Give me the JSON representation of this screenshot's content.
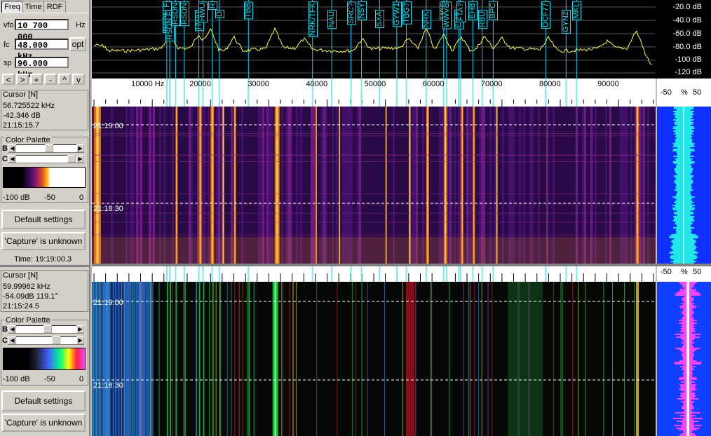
{
  "tabs": [
    "Freq",
    "Time",
    "RDF"
  ],
  "params": {
    "vfo_label": "vfo",
    "vfo_value": "10 700 000",
    "vfo_unit": "Hz",
    "fc_label": "fc",
    "fc_value": "48.000 kHz",
    "sp_label": "sp",
    "sp_value": "96.000 kHz",
    "opt_label": "opt"
  },
  "nav_buttons": [
    "<",
    ">",
    "+",
    "-",
    "^",
    "v"
  ],
  "panel1": {
    "cursor_title": "Cursor [N]",
    "cursor_freq": "56.725522 kHz",
    "cursor_level": "-42.346 dB",
    "cursor_time": "21:15:15.7",
    "palette_title": "Color Palette",
    "b_label": "B",
    "c_label": "C",
    "palette_min": "-100 dB",
    "palette_mid": "-50",
    "palette_max": "0",
    "default_btn": "Default settings",
    "capture_btn": "'Capture' is unknown",
    "time_status": "Time:  19:19:00.3"
  },
  "panel2": {
    "cursor_title": "Cursor [N]",
    "cursor_freq": "59.99962 kHz",
    "cursor_level": "-54.09dB 119.1°",
    "cursor_time": "21:15:24.5",
    "palette_title": "Color Palette",
    "b_label": "B",
    "c_label": "C",
    "palette_min": "-100 dB",
    "palette_mid": "-50",
    "palette_max": "0",
    "default_btn": "Default settings",
    "capture_btn": "'Capture' is unknown"
  },
  "db_scale": [
    "-20.0 dB",
    "-40.0 dB",
    "-60.0 dB",
    "-80.0 dB",
    "-100 dB",
    "-120 dB"
  ],
  "freq_axis": [
    "10000 Hz",
    "20000",
    "30000",
    "40000",
    "50000",
    "60000",
    "70000",
    "80000",
    "90000"
  ],
  "pct_axis": {
    "left": "-50",
    "mid": "%",
    "right": "50"
  },
  "wf_times": [
    "21:19:00",
    "21:18:30"
  ],
  "stations": [
    {
      "label": "RSDN F",
      "f": 12500
    },
    {
      "label": "RSDN F",
      "f": 13000
    },
    {
      "label": "RSDN",
      "f": 14000
    },
    {
      "label": "RSDN",
      "f": 15500
    },
    {
      "label": "HWU",
      "f": 18000
    },
    {
      "label": "HWU",
      "f": 18700
    },
    {
      "label": "R",
      "f": 20300
    },
    {
      "label": "D",
      "f": 21500
    },
    {
      "label": "TBB",
      "f": 26500
    },
    {
      "label": "NRK/TFK",
      "f": 37500
    },
    {
      "label": "NAU",
      "f": 40800
    },
    {
      "label": "SRC?",
      "f": 44100
    },
    {
      "label": "NSY",
      "f": 45900
    },
    {
      "label": "SXA",
      "f": 49000
    },
    {
      "label": "GYW1",
      "f": 51950
    },
    {
      "label": "TBG?",
      "f": 53600
    },
    {
      "label": "NRK",
      "f": 57000
    },
    {
      "label": "MSF",
      "f": 60000
    },
    {
      "label": "WWVB",
      "f": 60500
    },
    {
      "label": "EHG",
      "f": 62600
    },
    {
      "label": "FTA?",
      "f": 62900
    },
    {
      "label": "EHB",
      "f": 65000
    },
    {
      "label": "RBU",
      "f": 66600
    },
    {
      "label": "BPC",
      "f": 68500
    },
    {
      "label": "DCF77",
      "f": 77500
    },
    {
      "label": "GYN2",
      "f": 81000
    },
    {
      "label": "MKL",
      "f": 82800
    }
  ]
}
